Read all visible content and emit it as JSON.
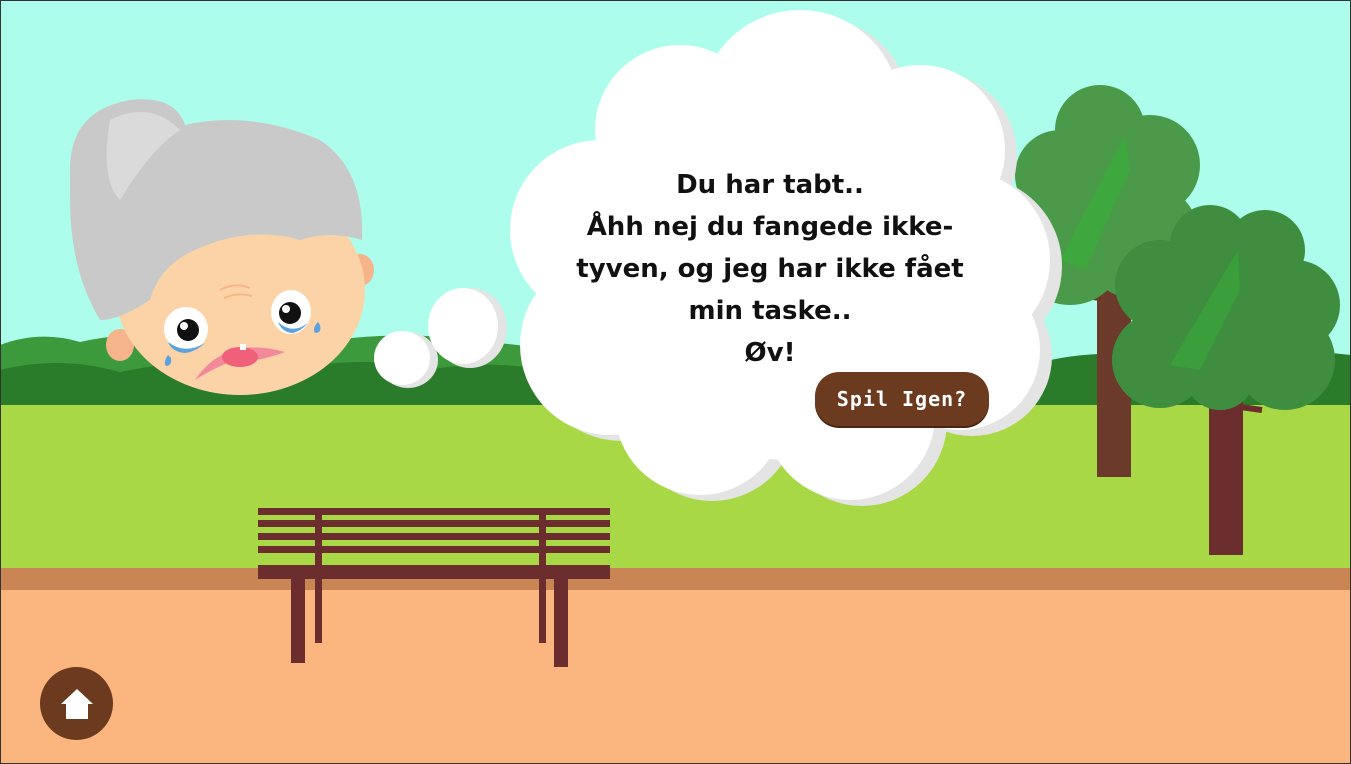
{
  "game": {
    "message_lines": [
      "Du har tabt..",
      "Åhh nej du fangede ikke-",
      "tyven, og jeg har ikke fået",
      "min taske..",
      "Øv!"
    ],
    "play_again_label": "Spil Igen?",
    "home_icon": "home-icon"
  },
  "colors": {
    "sky": "#adfded",
    "grass": "#a9d846",
    "path_edge": "#c98654",
    "ground": "#fbb67f",
    "button_brown": "#6b3a1f",
    "tree_green": "#3f8e3f",
    "bench_brown": "#6b2d2d"
  }
}
